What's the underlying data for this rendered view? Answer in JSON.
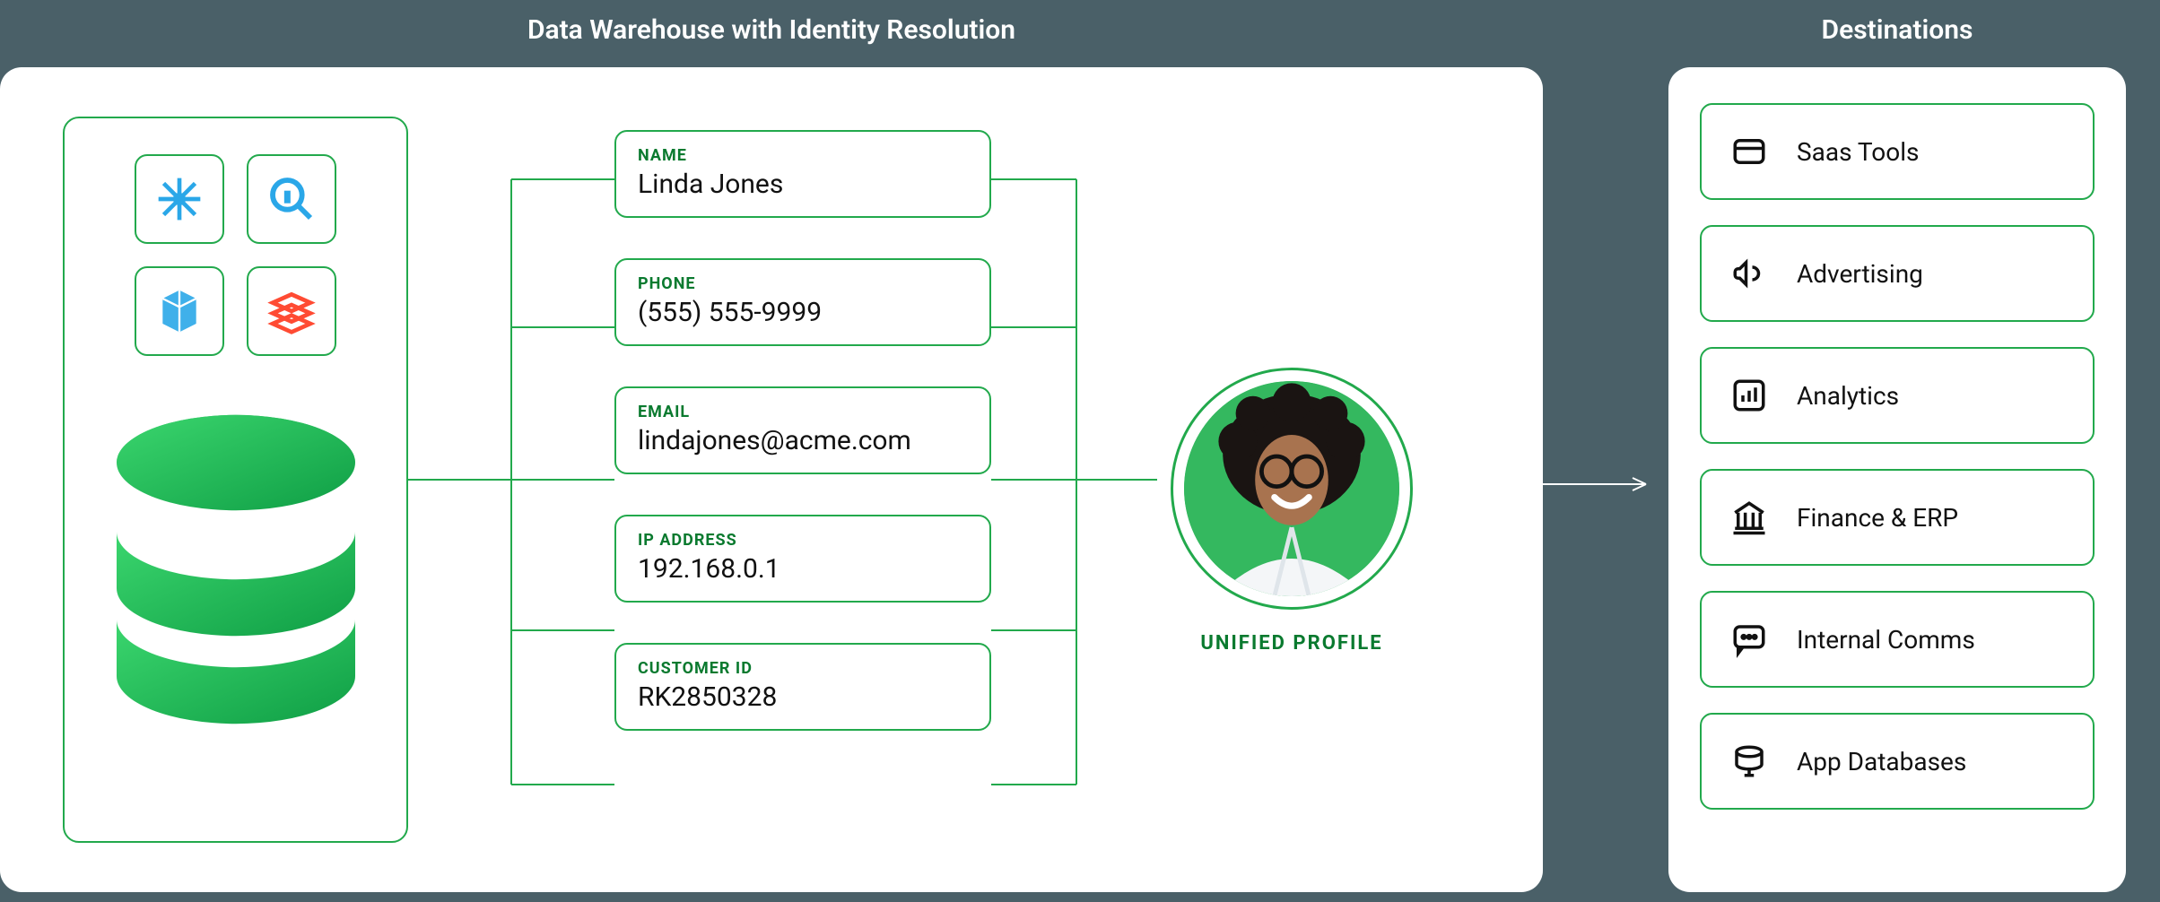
{
  "titles": {
    "main": "Data Warehouse with Identity Resolution",
    "destinations": "Destinations"
  },
  "warehouse": {
    "sources": [
      {
        "name": "snowflake",
        "color": "#2aa7e8"
      },
      {
        "name": "bigquery",
        "color": "#2aa7e8"
      },
      {
        "name": "redshift",
        "color": "#2aa7e8"
      },
      {
        "name": "databricks",
        "color": "#ff4b33"
      }
    ]
  },
  "fields": [
    {
      "label": "NAME",
      "value": "Linda Jones"
    },
    {
      "label": "PHONE",
      "value": "(555) 555-9999"
    },
    {
      "label": "EMAIL",
      "value": "lindajones@acme.com"
    },
    {
      "label": "IP ADDRESS",
      "value": "192.168.0.1"
    },
    {
      "label": "CUSTOMER ID",
      "value": "RK2850328"
    }
  ],
  "profile": {
    "label": "UNIFIED PROFILE"
  },
  "destinations": [
    {
      "icon": "saas",
      "label": "Saas Tools"
    },
    {
      "icon": "advertising",
      "label": "Advertising"
    },
    {
      "icon": "analytics",
      "label": "Analytics"
    },
    {
      "icon": "finance",
      "label": "Finance & ERP"
    },
    {
      "icon": "comms",
      "label": "Internal Comms"
    },
    {
      "icon": "database",
      "label": "App Databases"
    }
  ],
  "colors": {
    "accent": "#22a94c",
    "accentDark": "#0a7a2f",
    "bg": "#4a6068"
  }
}
